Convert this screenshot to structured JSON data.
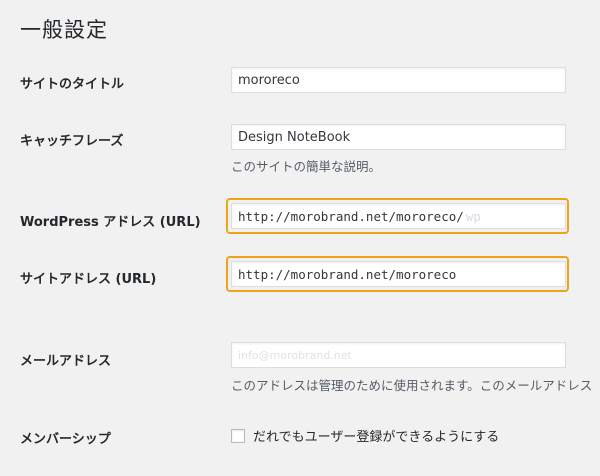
{
  "page": {
    "title": "一般設定"
  },
  "settings": {
    "site_title": {
      "label": "サイトのタイトル",
      "value": "mororeco"
    },
    "tagline": {
      "label": "キャッチフレーズ",
      "value": "Design NoteBook",
      "description": "このサイトの簡単な説明。"
    },
    "wp_address": {
      "label": "WordPress アドレス (URL)",
      "value": "http://morobrand.net/mororeco/",
      "blurred_tail": "wp"
    },
    "site_address": {
      "label": "サイトアドレス (URL)",
      "value": "http://morobrand.net/mororeco"
    },
    "email": {
      "label": "メールアドレス",
      "value": "info@morobrand.net",
      "description": "このアドレスは管理のために使用されます。このメールアドレス"
    },
    "membership": {
      "label": "メンバーシップ",
      "checkbox_label": "だれでもユーザー登録ができるようにする",
      "checked": false
    }
  },
  "colors": {
    "highlight": "#f0a21c",
    "background": "#f1f1f1"
  }
}
